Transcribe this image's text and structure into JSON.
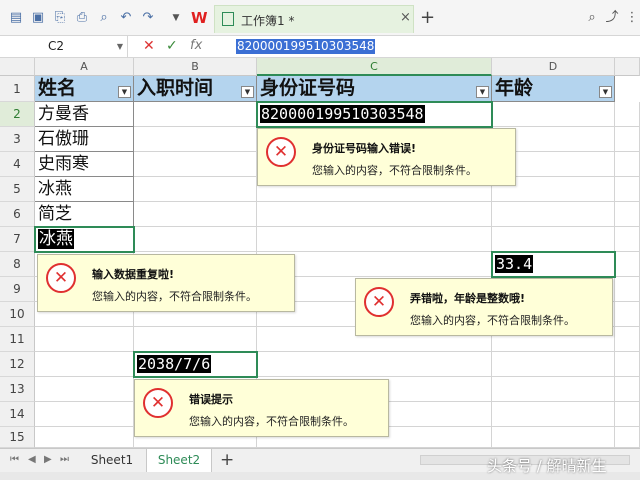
{
  "toolbar": {
    "app_logo": "W",
    "doc_tab_title": "工作簿1 *",
    "tab_close": "×",
    "new_tab": "+"
  },
  "formula_bar": {
    "cell_ref": "C2",
    "cancel": "✕",
    "confirm": "✓",
    "fx": "fx",
    "value": "820000199510303548"
  },
  "columns": [
    "A",
    "B",
    "C",
    "D"
  ],
  "rows": [
    "1",
    "2",
    "3",
    "4",
    "5",
    "6",
    "7",
    "8",
    "9",
    "10",
    "11",
    "12",
    "13",
    "14",
    "15"
  ],
  "headers": [
    "姓名",
    "入职时间",
    "身份证号码",
    "年龄"
  ],
  "names": [
    "方曼香",
    "石傲珊",
    "史雨寒",
    "冰燕",
    "简芝",
    "冰燕"
  ],
  "highlighted": {
    "id_number": "820000199510303548",
    "duplicate_name": "冰燕",
    "age": "33.4",
    "date": "2038/7/6"
  },
  "errors": {
    "id": {
      "title": "身份证号码输入错误!",
      "msg": "您输入的内容，不符合限制条件。"
    },
    "dup": {
      "title": "输入数据重复啦!",
      "msg": "您输入的内容，不符合限制条件。"
    },
    "age": {
      "title": "弄错啦，年龄是整数哦!",
      "msg": "您输入的内容，不符合限制条件。"
    },
    "date": {
      "title": "错误提示",
      "msg": "您输入的内容，不符合限制条件。"
    },
    "icon": "✕"
  },
  "sheets": [
    "Sheet1",
    "Sheet2"
  ],
  "active_sheet": "Sheet2",
  "add_sheet": "+",
  "watermark": "头条号 / 解晴新生",
  "colors": {
    "header_fill": "#b4d4ee",
    "selection": "#2e8b57",
    "error_bg": "#ffffd8",
    "error_icon": "#e03030"
  }
}
